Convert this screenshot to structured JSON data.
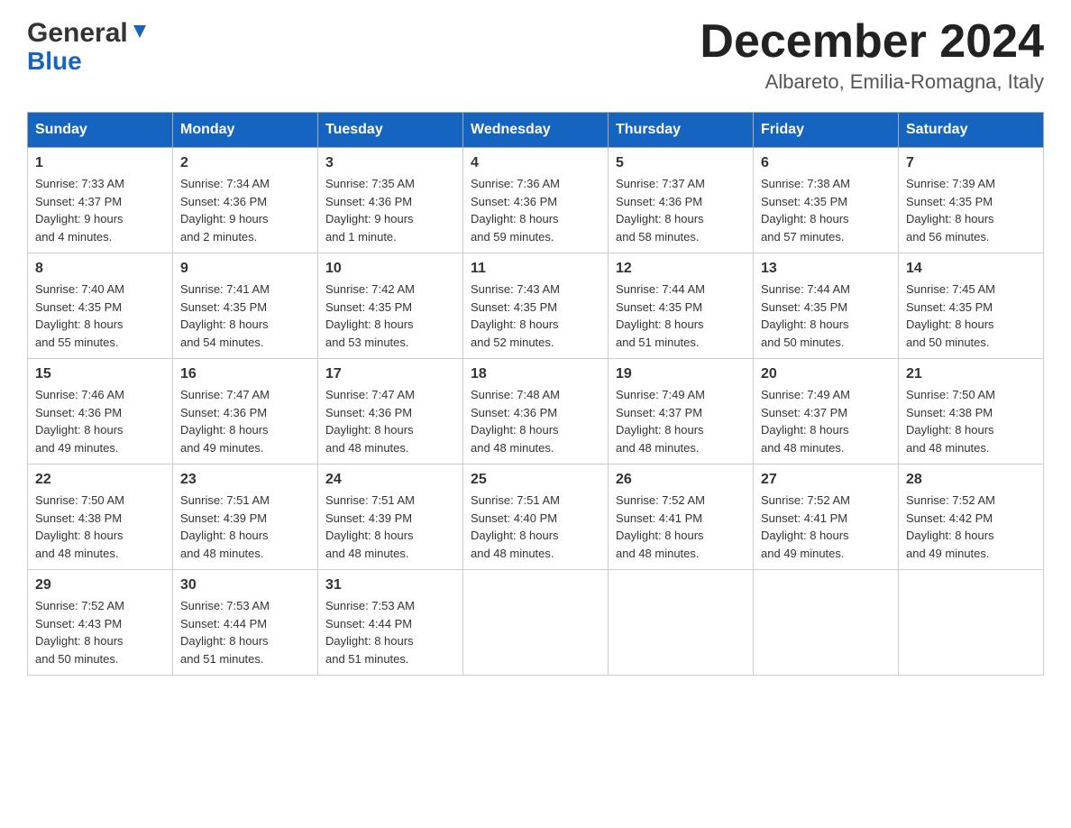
{
  "header": {
    "logo_general": "General",
    "logo_blue": "Blue",
    "month_title": "December 2024",
    "location": "Albareto, Emilia-Romagna, Italy"
  },
  "days_of_week": [
    "Sunday",
    "Monday",
    "Tuesday",
    "Wednesday",
    "Thursday",
    "Friday",
    "Saturday"
  ],
  "weeks": [
    [
      {
        "day": "1",
        "sunrise": "7:33 AM",
        "sunset": "4:37 PM",
        "daylight": "9 hours and 4 minutes."
      },
      {
        "day": "2",
        "sunrise": "7:34 AM",
        "sunset": "4:36 PM",
        "daylight": "9 hours and 2 minutes."
      },
      {
        "day": "3",
        "sunrise": "7:35 AM",
        "sunset": "4:36 PM",
        "daylight": "9 hours and 1 minute."
      },
      {
        "day": "4",
        "sunrise": "7:36 AM",
        "sunset": "4:36 PM",
        "daylight": "8 hours and 59 minutes."
      },
      {
        "day": "5",
        "sunrise": "7:37 AM",
        "sunset": "4:36 PM",
        "daylight": "8 hours and 58 minutes."
      },
      {
        "day": "6",
        "sunrise": "7:38 AM",
        "sunset": "4:35 PM",
        "daylight": "8 hours and 57 minutes."
      },
      {
        "day": "7",
        "sunrise": "7:39 AM",
        "sunset": "4:35 PM",
        "daylight": "8 hours and 56 minutes."
      }
    ],
    [
      {
        "day": "8",
        "sunrise": "7:40 AM",
        "sunset": "4:35 PM",
        "daylight": "8 hours and 55 minutes."
      },
      {
        "day": "9",
        "sunrise": "7:41 AM",
        "sunset": "4:35 PM",
        "daylight": "8 hours and 54 minutes."
      },
      {
        "day": "10",
        "sunrise": "7:42 AM",
        "sunset": "4:35 PM",
        "daylight": "8 hours and 53 minutes."
      },
      {
        "day": "11",
        "sunrise": "7:43 AM",
        "sunset": "4:35 PM",
        "daylight": "8 hours and 52 minutes."
      },
      {
        "day": "12",
        "sunrise": "7:44 AM",
        "sunset": "4:35 PM",
        "daylight": "8 hours and 51 minutes."
      },
      {
        "day": "13",
        "sunrise": "7:44 AM",
        "sunset": "4:35 PM",
        "daylight": "8 hours and 50 minutes."
      },
      {
        "day": "14",
        "sunrise": "7:45 AM",
        "sunset": "4:35 PM",
        "daylight": "8 hours and 50 minutes."
      }
    ],
    [
      {
        "day": "15",
        "sunrise": "7:46 AM",
        "sunset": "4:36 PM",
        "daylight": "8 hours and 49 minutes."
      },
      {
        "day": "16",
        "sunrise": "7:47 AM",
        "sunset": "4:36 PM",
        "daylight": "8 hours and 49 minutes."
      },
      {
        "day": "17",
        "sunrise": "7:47 AM",
        "sunset": "4:36 PM",
        "daylight": "8 hours and 48 minutes."
      },
      {
        "day": "18",
        "sunrise": "7:48 AM",
        "sunset": "4:36 PM",
        "daylight": "8 hours and 48 minutes."
      },
      {
        "day": "19",
        "sunrise": "7:49 AM",
        "sunset": "4:37 PM",
        "daylight": "8 hours and 48 minutes."
      },
      {
        "day": "20",
        "sunrise": "7:49 AM",
        "sunset": "4:37 PM",
        "daylight": "8 hours and 48 minutes."
      },
      {
        "day": "21",
        "sunrise": "7:50 AM",
        "sunset": "4:38 PM",
        "daylight": "8 hours and 48 minutes."
      }
    ],
    [
      {
        "day": "22",
        "sunrise": "7:50 AM",
        "sunset": "4:38 PM",
        "daylight": "8 hours and 48 minutes."
      },
      {
        "day": "23",
        "sunrise": "7:51 AM",
        "sunset": "4:39 PM",
        "daylight": "8 hours and 48 minutes."
      },
      {
        "day": "24",
        "sunrise": "7:51 AM",
        "sunset": "4:39 PM",
        "daylight": "8 hours and 48 minutes."
      },
      {
        "day": "25",
        "sunrise": "7:51 AM",
        "sunset": "4:40 PM",
        "daylight": "8 hours and 48 minutes."
      },
      {
        "day": "26",
        "sunrise": "7:52 AM",
        "sunset": "4:41 PM",
        "daylight": "8 hours and 48 minutes."
      },
      {
        "day": "27",
        "sunrise": "7:52 AM",
        "sunset": "4:41 PM",
        "daylight": "8 hours and 49 minutes."
      },
      {
        "day": "28",
        "sunrise": "7:52 AM",
        "sunset": "4:42 PM",
        "daylight": "8 hours and 49 minutes."
      }
    ],
    [
      {
        "day": "29",
        "sunrise": "7:52 AM",
        "sunset": "4:43 PM",
        "daylight": "8 hours and 50 minutes."
      },
      {
        "day": "30",
        "sunrise": "7:53 AM",
        "sunset": "4:44 PM",
        "daylight": "8 hours and 51 minutes."
      },
      {
        "day": "31",
        "sunrise": "7:53 AM",
        "sunset": "4:44 PM",
        "daylight": "8 hours and 51 minutes."
      },
      null,
      null,
      null,
      null
    ]
  ],
  "labels": {
    "sunrise": "Sunrise:",
    "sunset": "Sunset:",
    "daylight": "Daylight:"
  }
}
